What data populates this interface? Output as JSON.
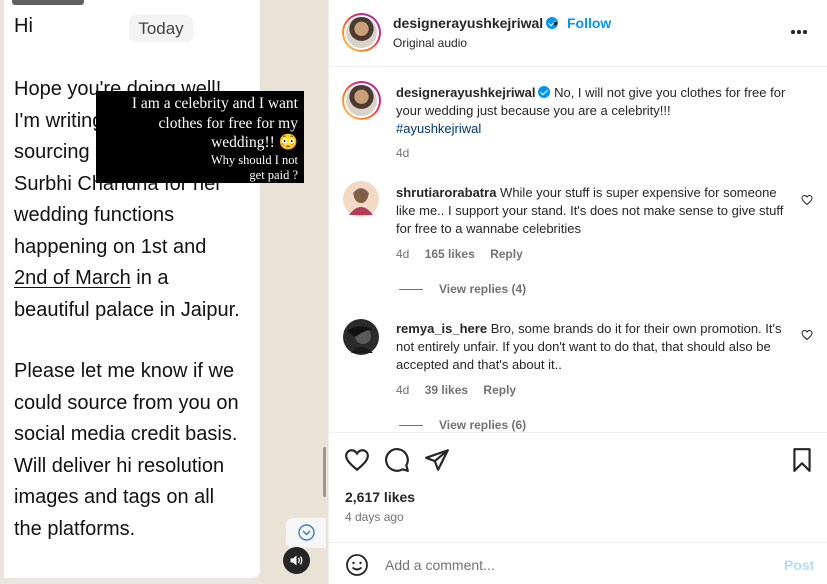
{
  "video": {
    "greeting": "Hi",
    "today_label": "Today",
    "body_line1": "Hope you're doing well!",
    "body_line2": "I'm writing for a",
    "body_line3": "sourcing request for",
    "body_line4": "Surbhi Chandna for her",
    "body_line5": "wedding functions",
    "body_line6": "happening on 1st and",
    "body_line7_link": "2nd of March",
    "body_line7_rest": " in a",
    "body_line8": "beautiful palace in Jaipur.",
    "body2_line1": "Please let me know if we",
    "body2_line2": "could source from you on",
    "body2_line3": "social media credit basis.",
    "body2_line4": "Will deliver hi resolution",
    "body2_line5": "images and tags on all",
    "body2_line6": "the platforms.",
    "overlay_line1": "I am a celebrity and I want",
    "overlay_line2": "clothes for free for my",
    "overlay_line3": "wedding!! 😳",
    "overlay_line4": "Why should I not",
    "overlay_line5": "get paid ?"
  },
  "header": {
    "username": "designerayushkejriwal",
    "separator": "•",
    "follow_label": "Follow",
    "audio_label": "Original audio"
  },
  "caption": {
    "username": "designerayushkejriwal",
    "text": "No, I will not give you clothes for free for your wedding just because you are a celebrity!!!",
    "hashtag": "#ayushkejriwal",
    "time": "4d"
  },
  "comments": [
    {
      "username": "shrutiarorabatra",
      "text": "While your stuff is super expensive for someone like me.. I support your stand. It's does not make sense to give stuff for free to a wannabe celebrities",
      "time": "4d",
      "likes": "165 likes",
      "reply": "Reply",
      "view_replies": "View replies (4)"
    },
    {
      "username": "remya_is_here",
      "text": "Bro, some brands do it for their own promotion. It's not entirely unfair. If you don't want to do that, that should also be accepted and that's about it..",
      "time": "4d",
      "likes": "39 likes",
      "reply": "Reply",
      "view_replies": "View replies (6)"
    }
  ],
  "stats": {
    "likes": "2,617 likes",
    "date": "4 days ago"
  },
  "composer": {
    "placeholder": "Add a comment...",
    "post_label": "Post"
  },
  "colors": {
    "accent": "#0095f6",
    "hashtag": "#00376b",
    "muted": "#737373",
    "post_disabled": "#b3dbff"
  }
}
